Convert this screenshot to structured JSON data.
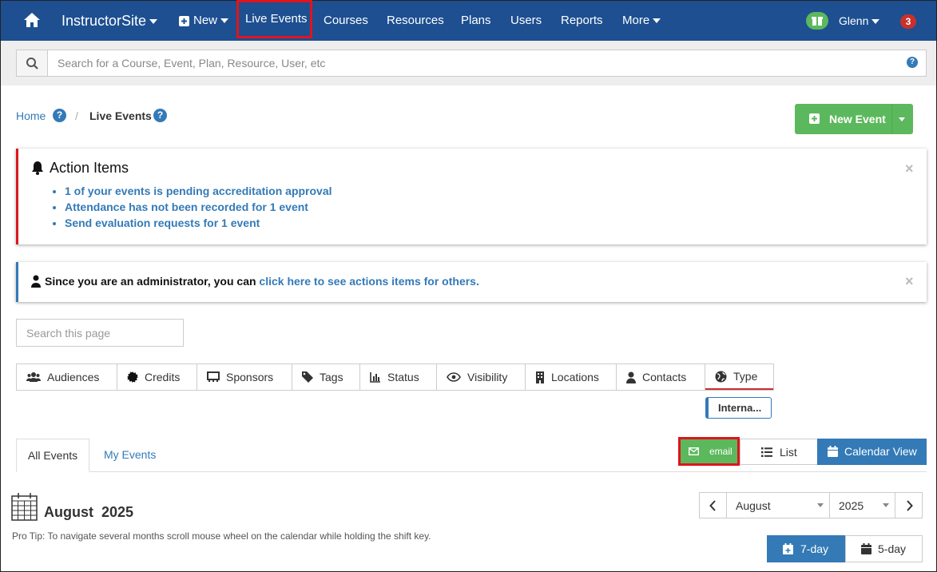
{
  "nav": {
    "brand": "InstructorSite",
    "new_label": "New",
    "live_events": "Live Events",
    "courses": "Courses",
    "resources": "Resources",
    "plans": "Plans",
    "users": "Users",
    "reports": "Reports",
    "more": "More",
    "user": "Glenn",
    "notification_count": "3"
  },
  "search": {
    "placeholder": "Search for a Course, Event, Plan, Resource, User, etc"
  },
  "breadcrumb": {
    "home": "Home",
    "current": "Live Events"
  },
  "new_event_label": "New Event",
  "action_items": {
    "title": "Action Items",
    "items": [
      "1 of your events is pending accreditation approval",
      "Attendance has not been recorded for 1 event",
      "Send evaluation requests for 1 event"
    ]
  },
  "admin_notice": {
    "text": "Since you are an administrator, you can",
    "link": "click here to see actions items for others."
  },
  "page_search": {
    "placeholder": "Search this page"
  },
  "filters": [
    "Audiences",
    "Credits",
    "Sponsors",
    "Tags",
    "Status",
    "Visibility",
    "Locations",
    "Contacts",
    "Type"
  ],
  "type_chip": "Interna...",
  "tabs": {
    "all": "All Events",
    "mine": "My Events"
  },
  "view": {
    "email": "email",
    "list": "List",
    "calendar": "Calendar View"
  },
  "calendar": {
    "heading": "August  2025",
    "tip": "Pro Tip: To navigate several months scroll mouse wheel on the calendar while holding the shift key.",
    "month_select": "August",
    "year_select": "2025",
    "seven_day": "7-day",
    "five_day": "5-day"
  },
  "colors": {
    "nav": "#1d4f91",
    "green": "#5cb85c",
    "blue": "#337ab7",
    "highlight": "#e0141c"
  }
}
